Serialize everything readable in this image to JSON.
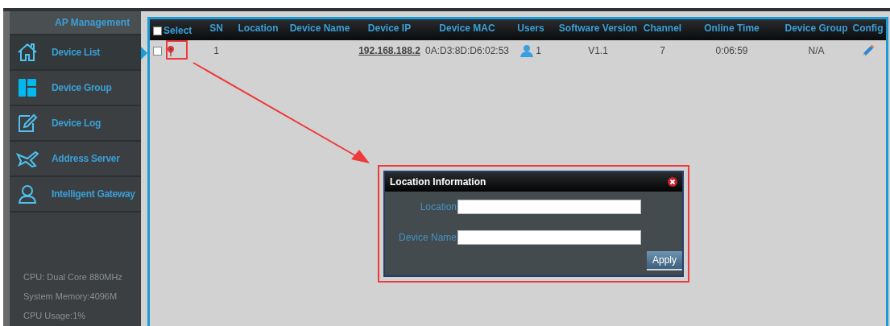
{
  "sidebar": {
    "title": "AP Management",
    "items": [
      {
        "label": "Device List",
        "selected": true
      },
      {
        "label": "Device Group",
        "selected": false
      },
      {
        "label": "Device Log",
        "selected": false
      },
      {
        "label": "Address Server",
        "selected": false
      },
      {
        "label": "Intelligent Gateway",
        "selected": false
      }
    ],
    "stats": [
      "CPU: Dual Core 880MHz",
      "System Memory:4096M",
      "CPU Usage:1%"
    ]
  },
  "table": {
    "select_all": {
      "label": "Select",
      "checked": false
    },
    "columns": [
      "SN",
      "Location",
      "Device Name",
      "Device IP",
      "Device MAC",
      "Users",
      "Software Version",
      "Channel",
      "Online Time",
      "Device Group",
      "Config"
    ],
    "rows": [
      {
        "checked": false,
        "sn": "1",
        "device_ip": "192.168.188.2",
        "device_mac": "0A:D3:8D:D6:02:53",
        "users": "1",
        "software_version": "V1.1",
        "channel": "7",
        "online_time": "0:06:59",
        "device_group": "N/A"
      }
    ]
  },
  "dialog": {
    "title": "Location Information",
    "fields": [
      {
        "label": "Location"
      },
      {
        "label": "Device Name"
      }
    ],
    "button": "Apply"
  }
}
